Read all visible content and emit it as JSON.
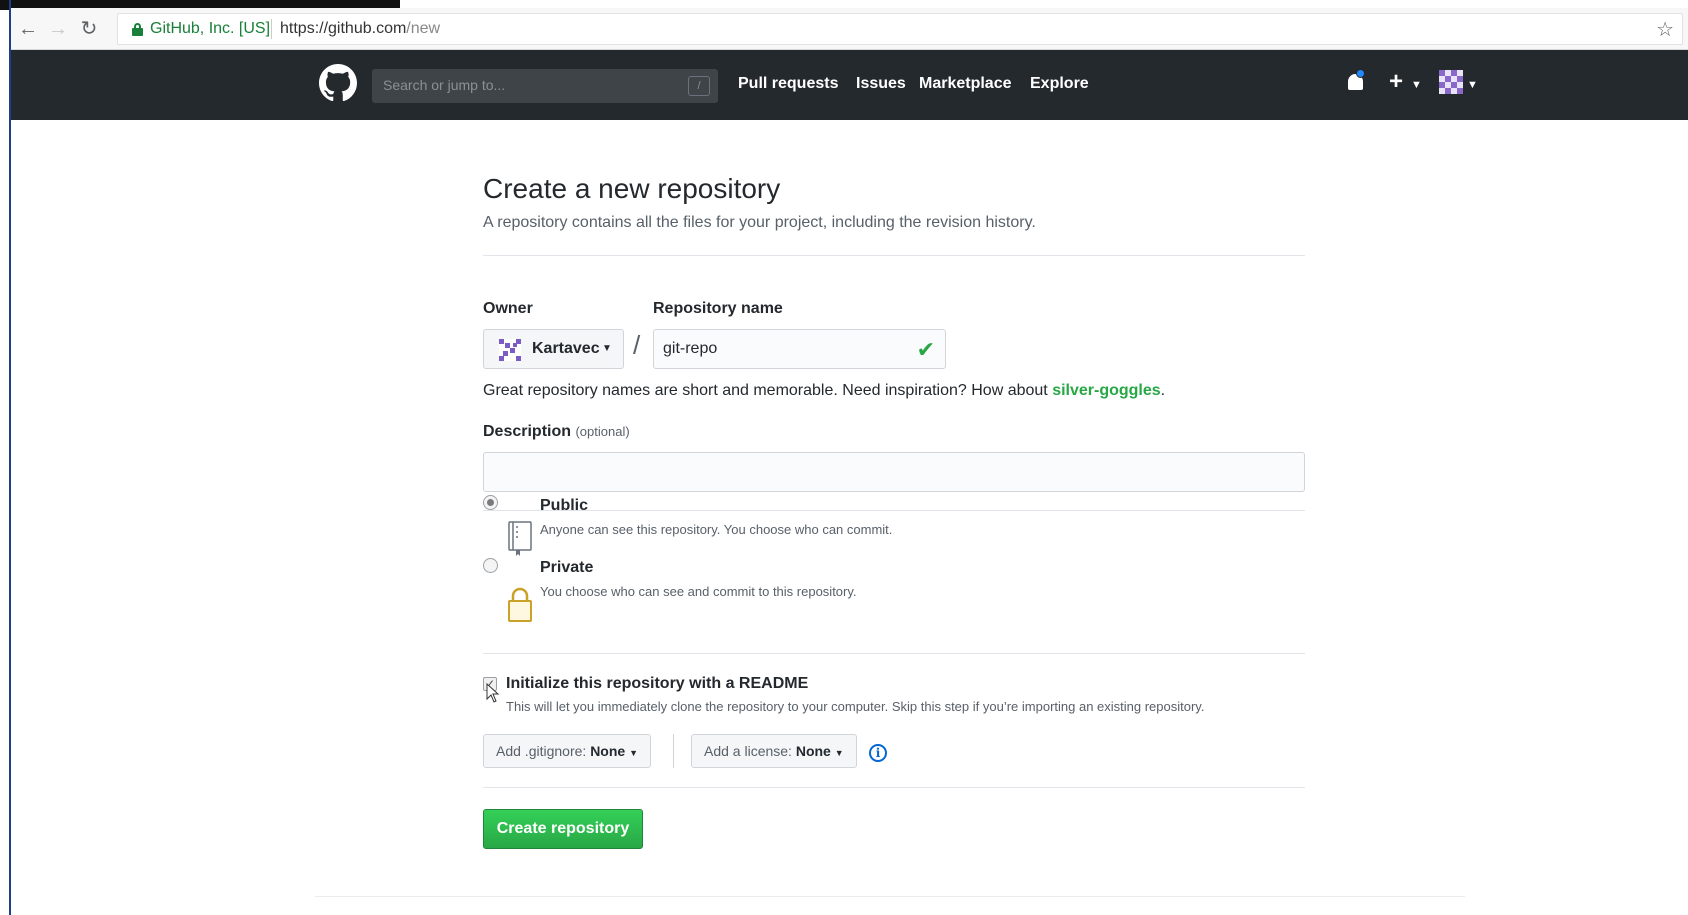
{
  "browser": {
    "site_identity": "GitHub, Inc. [US]",
    "url_host": "https://github.com",
    "url_path": "/new"
  },
  "header": {
    "search_placeholder": "Search or jump to...",
    "search_shortcut": "/",
    "nav": [
      "Pull requests",
      "Issues",
      "Marketplace",
      "Explore"
    ],
    "plus_icon": "plus-icon",
    "notification_icon": "bell-icon"
  },
  "page": {
    "title": "Create a new repository",
    "subtitle": "A repository contains all the files for your project, including the revision history.",
    "owner_label": "Owner",
    "owner_value": "Kartavec",
    "repo_name_label": "Repository name",
    "repo_name_value": "git-repo",
    "name_hint_prefix": "Great repository names are short and memorable. Need inspiration? How about ",
    "name_hint_suggestion": "silver-goggles",
    "name_hint_suffix": ".",
    "description_label": "Description",
    "description_optional": "(optional)",
    "description_value": "",
    "visibility": {
      "selected": "public",
      "public_title": "Public",
      "public_desc": "Anyone can see this repository. You choose who can commit.",
      "private_title": "Private",
      "private_desc": "You choose who can see and commit to this repository."
    },
    "init_readme": {
      "checked": true,
      "title": "Initialize this repository with a README",
      "desc": "This will let you immediately clone the repository to your computer. Skip this step if you’re importing an existing repository."
    },
    "gitignore_label": "Add .gitignore:",
    "gitignore_value": "None",
    "license_label": "Add a license:",
    "license_value": "None",
    "create_button": "Create repository"
  },
  "colors": {
    "header_bg": "#24292e",
    "primary_green": "#28a745",
    "link_blue": "#0366d6"
  }
}
